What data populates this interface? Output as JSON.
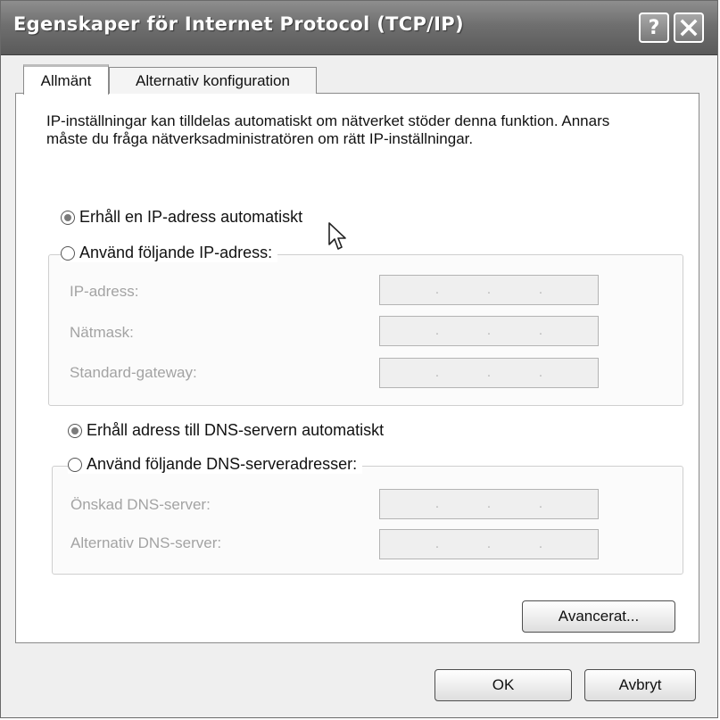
{
  "window": {
    "title": "Egenskaper för Internet Protocol (TCP/IP)",
    "help_label": "?"
  },
  "tabs": [
    {
      "label": "Allmänt",
      "active": true
    },
    {
      "label": "Alternativ konfiguration",
      "active": false
    }
  ],
  "general": {
    "intro": "IP-inställningar kan tilldelas automatiskt om nätverket stöder denna funktion. Annars måste du fråga nätverksadministratören om rätt IP-inställningar.",
    "ip": {
      "auto_label": "Erhåll en IP-adress automatiskt",
      "manual_label": "Använd följande IP-adress:",
      "selected": "auto",
      "fields": [
        {
          "label": "IP-adress:",
          "value": ""
        },
        {
          "label": "Nätmask:",
          "value": ""
        },
        {
          "label": "Standard-gateway:",
          "value": ""
        }
      ]
    },
    "dns": {
      "auto_label": "Erhåll adress till DNS-servern automatiskt",
      "manual_label": "Använd följande DNS-serveradresser:",
      "selected": "auto",
      "fields": [
        {
          "label": "Önskad DNS-server:",
          "value": ""
        },
        {
          "label": "Alternativ DNS-server:",
          "value": ""
        }
      ]
    },
    "advanced_label": "Avancerat..."
  },
  "footer": {
    "ok_label": "OK",
    "cancel_label": "Avbryt"
  },
  "icons": {
    "help": "help-icon",
    "close": "close-icon",
    "cursor": "mouse-pointer-icon"
  },
  "colors": {
    "titlebar": "#6f6f6f",
    "panel": "#ffffff",
    "disabled_text": "#a3a3a3"
  }
}
